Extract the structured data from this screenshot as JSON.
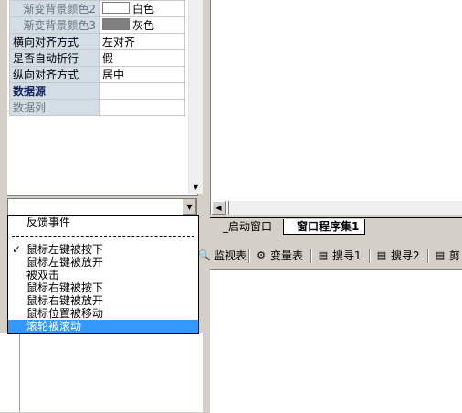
{
  "properties": [
    {
      "name": "渐变背景颜色2",
      "value": "白色",
      "swatch": "#ffffff",
      "style": "dim"
    },
    {
      "name": "渐变背景颜色3",
      "value": "灰色",
      "swatch": "#808080",
      "style": "dim"
    },
    {
      "name": "横向对齐方式",
      "value": "左对齐",
      "style": "normal"
    },
    {
      "name": "是否自动折行",
      "value": "假",
      "style": "normal"
    },
    {
      "name": "纵向对齐方式",
      "value": "居中",
      "style": "normal"
    },
    {
      "name": "数据源",
      "value": "",
      "style": "bold"
    },
    {
      "name": "数据列",
      "value": "",
      "style": "left-dim"
    }
  ],
  "combo": {
    "value": ""
  },
  "events": {
    "header": "反馈事件",
    "items": [
      {
        "label": "鼠标左键被按下",
        "checked": true,
        "selected": false
      },
      {
        "label": "鼠标左键被放开",
        "checked": false,
        "selected": false
      },
      {
        "label": "被双击",
        "checked": false,
        "selected": false
      },
      {
        "label": "鼠标右键被按下",
        "checked": false,
        "selected": false
      },
      {
        "label": "鼠标右键被放开",
        "checked": false,
        "selected": false
      },
      {
        "label": "鼠标位置被移动",
        "checked": false,
        "selected": false
      },
      {
        "label": "滚轮被滚动",
        "checked": false,
        "selected": true
      }
    ]
  },
  "tabs": [
    {
      "label": "_启动窗口",
      "active": false
    },
    {
      "label": "窗口程序集1",
      "active": true
    }
  ],
  "toolbar": [
    {
      "label": "监视表",
      "icon": "monitor-icon"
    },
    {
      "label": "变量表",
      "icon": "variables-icon"
    },
    {
      "label": "搜寻1",
      "icon": "search-icon"
    },
    {
      "label": "搜寻2",
      "icon": "search-icon"
    },
    {
      "label": "剪",
      "icon": "clipboard-icon"
    }
  ],
  "colors": {
    "selection": "#3399ff",
    "property_name_bg": "#d2dde6",
    "chrome": "#d4d0c8"
  }
}
